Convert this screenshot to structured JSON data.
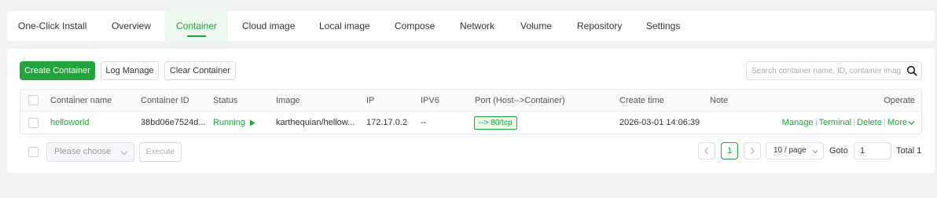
{
  "tabs": [
    {
      "label": "One-Click Install",
      "active": false
    },
    {
      "label": "Overview",
      "active": false
    },
    {
      "label": "Container",
      "active": true
    },
    {
      "label": "Cloud image",
      "active": false
    },
    {
      "label": "Local image",
      "active": false
    },
    {
      "label": "Compose",
      "active": false
    },
    {
      "label": "Network",
      "active": false
    },
    {
      "label": "Volume",
      "active": false
    },
    {
      "label": "Repository",
      "active": false
    },
    {
      "label": "Settings",
      "active": false
    }
  ],
  "toolbar": {
    "create_label": "Create Container",
    "log_label": "Log Manage",
    "clear_label": "Clear Container"
  },
  "search": {
    "placeholder": "Search container name, ID, container image"
  },
  "table": {
    "columns": [
      "Container name",
      "Container ID",
      "Status",
      "Image",
      "IP",
      "IPV6",
      "Port (Host-->Container)",
      "Create time",
      "Note",
      "Operate"
    ],
    "rows": [
      {
        "name": "helloworld",
        "id": "38bd06e7524d...",
        "status": "Running",
        "image": "karthequian/hellow...",
        "ip": "172.17.0.2",
        "ipv6": "--",
        "port": "--> 80/tcp",
        "create_time": "2026-03-01 14:06:39",
        "note": "",
        "ops": {
          "manage": "Manage",
          "terminal": "Terminal",
          "delete": "Delete",
          "more": "More"
        }
      }
    ]
  },
  "footer": {
    "batch_placeholder": "Please choose",
    "execute_label": "Execute",
    "current_page": "1",
    "page_size": "10 / page",
    "goto_label": "Goto",
    "goto_value": "1",
    "total_label": "Total 1"
  },
  "colors": {
    "accent": "#20a53a",
    "page_bg": "#f0f1f3"
  },
  "icons": {
    "search": "search-icon",
    "play": "play-icon",
    "prev": "chevron-left-icon",
    "next": "chevron-right-icon",
    "dropdown": "chevron-down-icon"
  }
}
